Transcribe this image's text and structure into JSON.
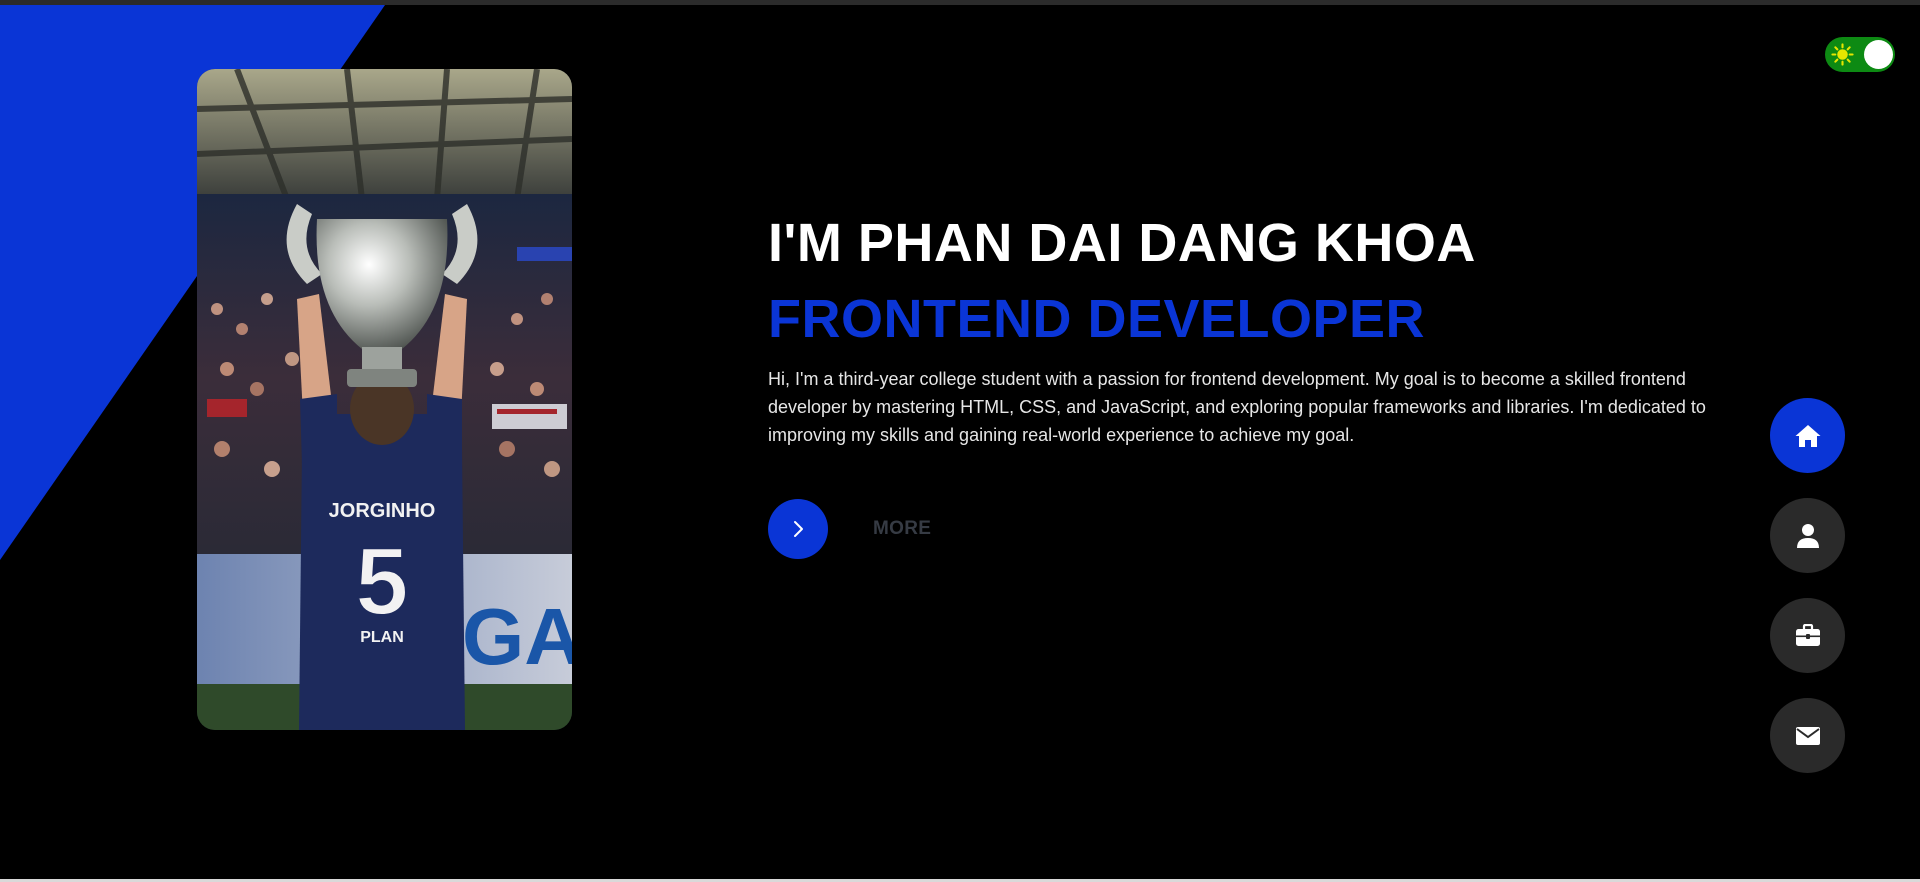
{
  "hero": {
    "title": "I'M PHAN DAI DANG KHOA",
    "subtitle": "FRONTEND DEVELOPER",
    "description": "Hi, I'm a third-year college student with a passion for frontend development. My goal is to become a skilled frontend developer by mastering HTML, CSS, and JavaScript, and exploring popular frameworks and libraries. I'm dedicated to improving my skills and gaining real-world experience to achieve my goal.",
    "more_label": "MORE",
    "more_icon": "chevron-right-icon"
  },
  "portrait": {
    "jersey_name": "JORGINHO",
    "jersey_number": "5",
    "sponsor": "PLAN",
    "board_text": "GA"
  },
  "theme_toggle": {
    "icon": "sun-icon",
    "state": "light-mode-on"
  },
  "side_nav": {
    "items": [
      {
        "id": "home",
        "icon": "home-icon",
        "active": true
      },
      {
        "id": "about",
        "icon": "user-icon",
        "active": false
      },
      {
        "id": "portfolio",
        "icon": "briefcase-icon",
        "active": false
      },
      {
        "id": "contact",
        "icon": "envelope-icon",
        "active": false
      }
    ]
  },
  "colors": {
    "background": "#000000",
    "accent": "#0a35d6",
    "nav_inactive": "#2a2a2a",
    "toggle_track": "#0d8a13",
    "sun": "#e6e600",
    "muted_text": "#363b44"
  }
}
